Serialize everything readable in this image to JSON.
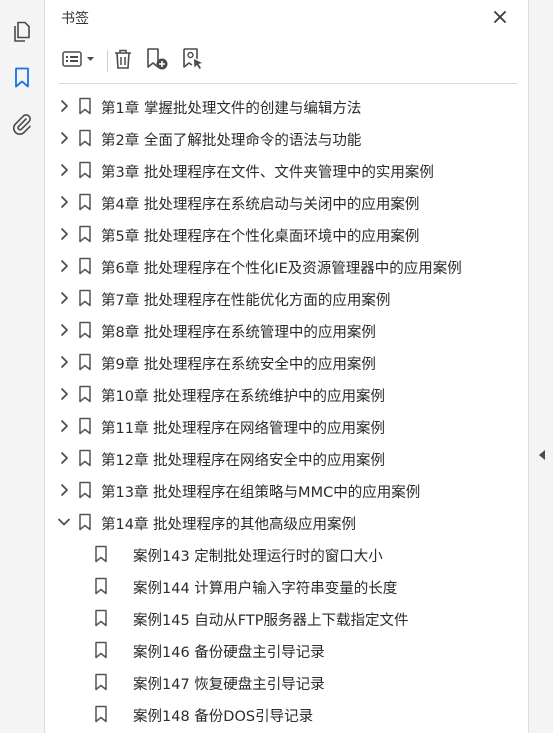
{
  "colors": {
    "accent": "#1473e6",
    "icon": "#4b4b4b",
    "panel_bg": "#ffffff",
    "rail_bg": "#f4f4f4"
  },
  "left_rail": {
    "items": [
      {
        "icon": "pages-icon"
      },
      {
        "icon": "bookmark-icon",
        "active": true
      },
      {
        "icon": "paperclip-icon"
      }
    ]
  },
  "panel": {
    "title": "书签",
    "toolbar": {
      "options_icon": "list-options-icon",
      "delete_icon": "trash-icon",
      "new_bookmark_icon": "add-bookmark-icon",
      "new_from_selection_icon": "bookmark-select-icon"
    }
  },
  "bookmarks": [
    {
      "label": "第1章 掌握批处理文件的创建与编辑方法",
      "expanded": false
    },
    {
      "label": "第2章 全面了解批处理命令的语法与功能",
      "expanded": false
    },
    {
      "label": "第3章 批处理程序在文件、文件夹管理中的实用案例",
      "expanded": false
    },
    {
      "label": "第4章 批处理程序在系统启动与关闭中的应用案例",
      "expanded": false
    },
    {
      "label": "第5章 批处理程序在个性化桌面环境中的应用案例",
      "expanded": false
    },
    {
      "label": "第6章 批处理程序在个性化IE及资源管理器中的应用案例",
      "expanded": false
    },
    {
      "label": "第7章 批处理程序在性能优化方面的应用案例",
      "expanded": false
    },
    {
      "label": "第8章 批处理程序在系统管理中的应用案例",
      "expanded": false
    },
    {
      "label": "第9章 批处理程序在系统安全中的应用案例",
      "expanded": false
    },
    {
      "label": "第10章 批处理程序在系统维护中的应用案例",
      "expanded": false
    },
    {
      "label": "第11章 批处理程序在网络管理中的应用案例",
      "expanded": false
    },
    {
      "label": "第12章 批处理程序在网络安全中的应用案例",
      "expanded": false
    },
    {
      "label": "第13章 批处理程序在组策略与MMC中的应用案例",
      "expanded": false
    },
    {
      "label": "第14章 批处理程序的其他高级应用案例",
      "expanded": true
    }
  ],
  "children": [
    {
      "label": "案例143 定制批处理运行时的窗口大小"
    },
    {
      "label": "案例144 计算用户输入字符串变量的长度"
    },
    {
      "label": "案例145 自动从FTP服务器上下载指定文件"
    },
    {
      "label": "案例146 备份硬盘主引导记录"
    },
    {
      "label": "案例147 恢复硬盘主引导记录"
    },
    {
      "label": "案例148 备份DOS引导记录"
    }
  ]
}
